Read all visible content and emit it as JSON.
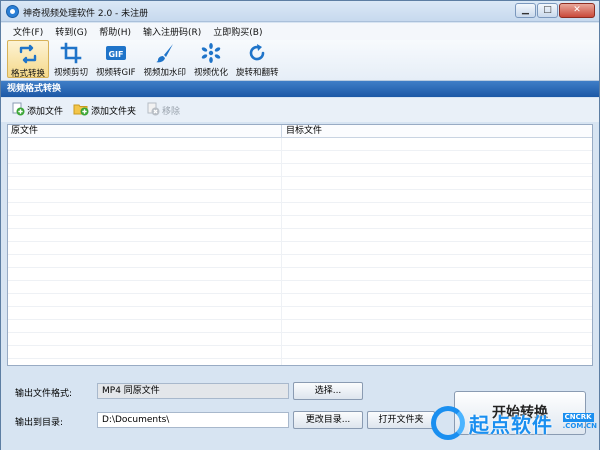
{
  "window": {
    "title": "神奇视频处理软件 2.0 - 未注册",
    "min_glyph": "▁",
    "max_glyph": "□",
    "close_glyph": "✕"
  },
  "menu": [
    {
      "label": "文件(F)"
    },
    {
      "label": "转到(G)"
    },
    {
      "label": "帮助(H)"
    },
    {
      "label": "输入注册码(R)"
    },
    {
      "label": "立即购买(B)"
    }
  ],
  "toolbar": [
    {
      "label": "格式转换",
      "icon": "convert-icon",
      "active": true
    },
    {
      "label": "视频剪切",
      "icon": "crop-icon"
    },
    {
      "label": "视频转GIF",
      "icon": "gif-icon"
    },
    {
      "label": "视频加水印",
      "icon": "brush-icon"
    },
    {
      "label": "视频优化",
      "icon": "optimize-icon"
    },
    {
      "label": "旋转和翻转",
      "icon": "rotate-icon"
    }
  ],
  "section": {
    "title": "视频格式转换"
  },
  "file_actions": {
    "add_file": "添加文件",
    "add_folder": "添加文件夹",
    "remove": "移除"
  },
  "table": {
    "columns": [
      "原文件",
      "目标文件"
    ],
    "rows": []
  },
  "output": {
    "format_label": "输出文件格式:",
    "format_value": "MP4 同原文件",
    "select_button": "选择...",
    "dir_label": "输出到目录:",
    "dir_value": "D:\\Documents\\",
    "change_dir_button": "更改目录...",
    "open_folder_button": "打开文件夹",
    "start_button": "开始转换"
  },
  "watermark": {
    "text": "起点软件",
    "tag": "CNCRK",
    "domain": ".COM.CN"
  },
  "colors": {
    "accent": "#1c58a6",
    "window_bg": "#d7e4f2",
    "close_btn": "#c9493a",
    "active_tool": "#f5d98b",
    "watermark": "#1a8ff0"
  }
}
